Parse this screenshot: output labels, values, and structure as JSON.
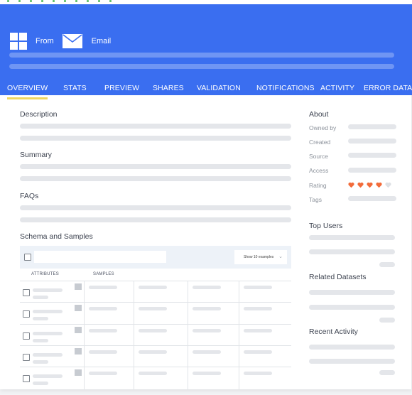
{
  "header": {
    "title": "From",
    "email_label": "Email",
    "app_icon": "grid-app-icon",
    "mail_icon": "envelope-icon",
    "color": "#3a6ef0"
  },
  "tabs": [
    {
      "label": "OVERVIEW",
      "active": true
    },
    {
      "label": "STATS",
      "active": false
    },
    {
      "label": "PREVIEW",
      "active": false
    },
    {
      "label": "SHARES",
      "active": false
    },
    {
      "label": "VALIDATION",
      "active": false
    },
    {
      "label": "NOTIFICATIONS",
      "active": false
    },
    {
      "label": "ACTIVITY",
      "active": false
    },
    {
      "label": "ERROR DATA",
      "active": false
    }
  ],
  "main": {
    "description_title": "Description",
    "summary_title": "Summary",
    "faqs_title": "FAQs",
    "schema_title": "Schema and Samples",
    "show_examples": "Show 10 examples",
    "col_attributes": "ATTRIBUTES",
    "col_samples": "SAMPLES"
  },
  "sidebar": {
    "about_title": "About",
    "fields": [
      "Owned by",
      "Created",
      "Source",
      "Access",
      "Rating",
      "Tags"
    ],
    "rating": {
      "value": 4,
      "max": 5,
      "filled_color": "#f26b3a",
      "empty_color": "#dde0e4"
    },
    "top_users_title": "Top Users",
    "related_title": "Related Datasets",
    "recent_title": "Recent Activity"
  }
}
